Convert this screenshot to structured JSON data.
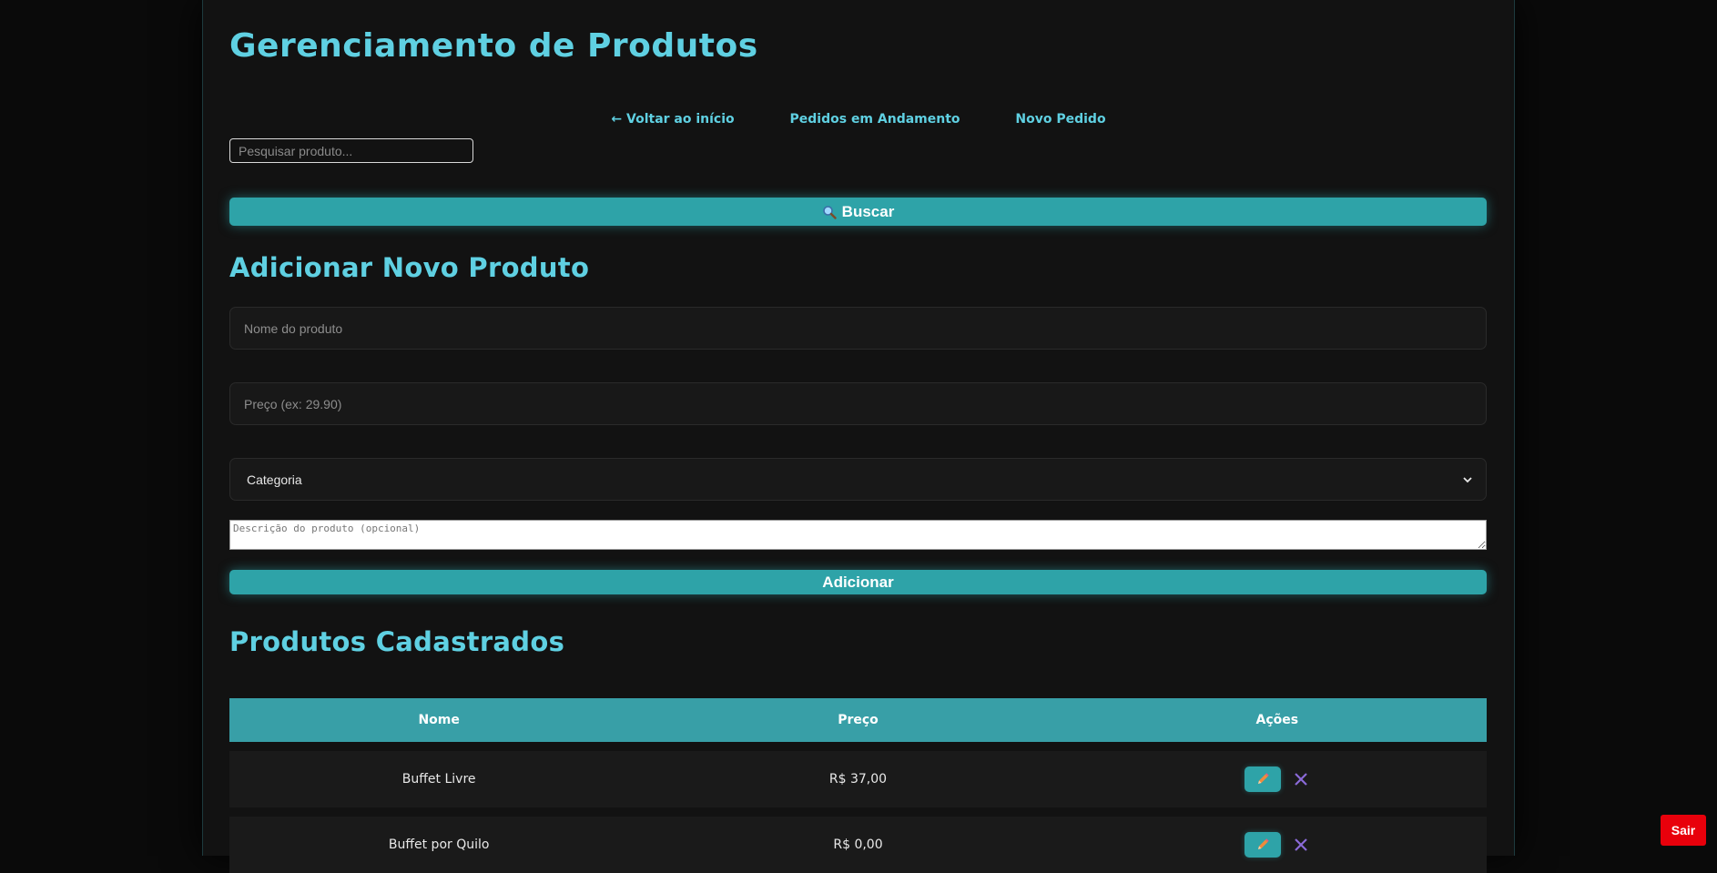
{
  "header": {
    "title": "Gerenciamento de Produtos"
  },
  "nav": {
    "back": "← Voltar ao início",
    "orders": "Pedidos em Andamento",
    "new_order": "Novo Pedido"
  },
  "search": {
    "placeholder": "Pesquisar produto...",
    "button_icon": "magnifier-icon",
    "button_label": "Buscar"
  },
  "add_product": {
    "heading": "Adicionar Novo Produto",
    "name_placeholder": "Nome do produto",
    "price_placeholder": "Preço (ex: 29.90)",
    "category_selected": "Categoria",
    "description_placeholder": "Descrição do produto (opcional)",
    "submit_label": "Adicionar"
  },
  "products": {
    "heading": "Produtos Cadastrados",
    "columns": [
      "Nome",
      "Preço",
      "Ações"
    ],
    "rows": [
      {
        "name": "Buffet Livre",
        "price": "R$ 37,00",
        "edit_icon": "pencil-icon",
        "delete_icon": "x-icon"
      },
      {
        "name": "Buffet por Quilo",
        "price": "R$ 0,00",
        "edit_icon": "pencil-icon",
        "delete_icon": "x-icon"
      }
    ]
  },
  "logout": {
    "label": "Sair"
  },
  "colors": {
    "accent": "#5fd0e2",
    "button": "#2ea3a8",
    "table_header": "#389fa7",
    "logout": "#e8000b"
  }
}
